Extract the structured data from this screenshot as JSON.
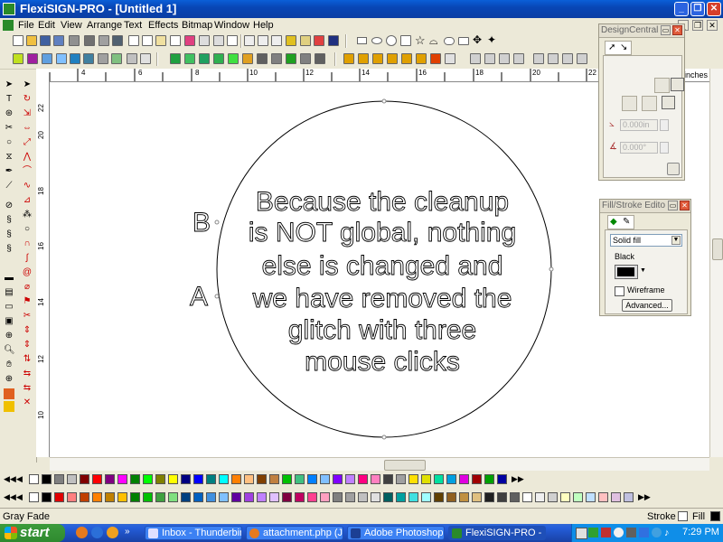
{
  "window": {
    "title": "FlexiSIGN-PRO - [Untitled 1]",
    "min_glyph": "_",
    "max_glyph": "❐",
    "close_glyph": "✕"
  },
  "menu": {
    "items": [
      {
        "label": "File"
      },
      {
        "label": "Edit"
      },
      {
        "label": "View"
      },
      {
        "label": "Arrange"
      },
      {
        "label": "Text"
      },
      {
        "label": "Effects"
      },
      {
        "label": "Bitmap"
      },
      {
        "label": "Window"
      },
      {
        "label": "Help"
      }
    ]
  },
  "ruler": {
    "unit_label": "inches",
    "h_labels": [
      "4",
      "6",
      "8",
      "10",
      "12",
      "14",
      "16",
      "18",
      "20",
      "22"
    ],
    "v_labels": [
      "22",
      "20",
      "18",
      "16",
      "14",
      "12",
      "10"
    ]
  },
  "canvas": {
    "letter_b": "B",
    "letter_a": "A",
    "lines": [
      "Because the cleanup",
      "is NOT global, nothing",
      "else is changed and",
      "we have removed the",
      "glitch with three",
      "mouse clicks"
    ]
  },
  "design_central": {
    "title": "DesignCentral",
    "field1": "0.000in",
    "field2": "0.000°"
  },
  "fill_stroke": {
    "title": "Fill/Stroke Edito",
    "fill_type": "Solid fill",
    "color_name": "Black",
    "color_hex": "#000000",
    "wireframe_label": "Wireframe",
    "advanced_label": "Advanced..."
  },
  "palette": {
    "row1": [
      "#ffffff",
      "#000000",
      "#808080",
      "#c0c0c0",
      "#800000",
      "#ff0000",
      "#800080",
      "#ff00ff",
      "#008000",
      "#00ff00",
      "#808000",
      "#ffff00",
      "#000080",
      "#0000ff",
      "#008080",
      "#00ffff",
      "#ff8000",
      "#ffc080",
      "#804000",
      "#c08040",
      "#00c000",
      "#40c080",
      "#0080ff",
      "#80c0ff",
      "#8000ff",
      "#c080ff",
      "#ff0080",
      "#ff80c0",
      "#404040",
      "#a0a0a0",
      "#ffe000",
      "#e0e000",
      "#00e0a0",
      "#00a0e0",
      "#e000e0",
      "#a00000",
      "#00a000",
      "#0000a0"
    ],
    "row2": [
      "#ffffff",
      "#000000",
      "#e00000",
      "#ff8080",
      "#c04000",
      "#ff8000",
      "#c08000",
      "#ffc000",
      "#008000",
      "#00c000",
      "#40a040",
      "#80e080",
      "#004080",
      "#0060c0",
      "#4090e0",
      "#80c0ff",
      "#6000a0",
      "#a040e0",
      "#c080ff",
      "#e0c0ff",
      "#800040",
      "#c00060",
      "#ff4090",
      "#ffa0c0",
      "#808080",
      "#a0a0a0",
      "#c0c0c0",
      "#e0e0e0",
      "#006060",
      "#00a0a0",
      "#40e0e0",
      "#a0ffff",
      "#604000",
      "#906020",
      "#c09040",
      "#e0c080",
      "#202020",
      "#404040",
      "#606060",
      "#ffffff",
      "#f0f0f0",
      "#d0d0d0",
      "#ffffc0",
      "#c0ffc0",
      "#c0e0ff",
      "#ffc0c0",
      "#e0c0e0",
      "#c0c0e0"
    ]
  },
  "status": {
    "left_text": "Gray Fade",
    "stroke_label": "Stroke",
    "fill_label": "Fill"
  },
  "taskbar": {
    "start_label": "start",
    "tasks": [
      {
        "label": "Inbox - Thunderbird"
      },
      {
        "label": "attachment.php (J..."
      },
      {
        "label": "Adobe Photoshop"
      },
      {
        "label": "FlexiSIGN-PRO - [..."
      }
    ],
    "clock": "7:29 PM"
  }
}
